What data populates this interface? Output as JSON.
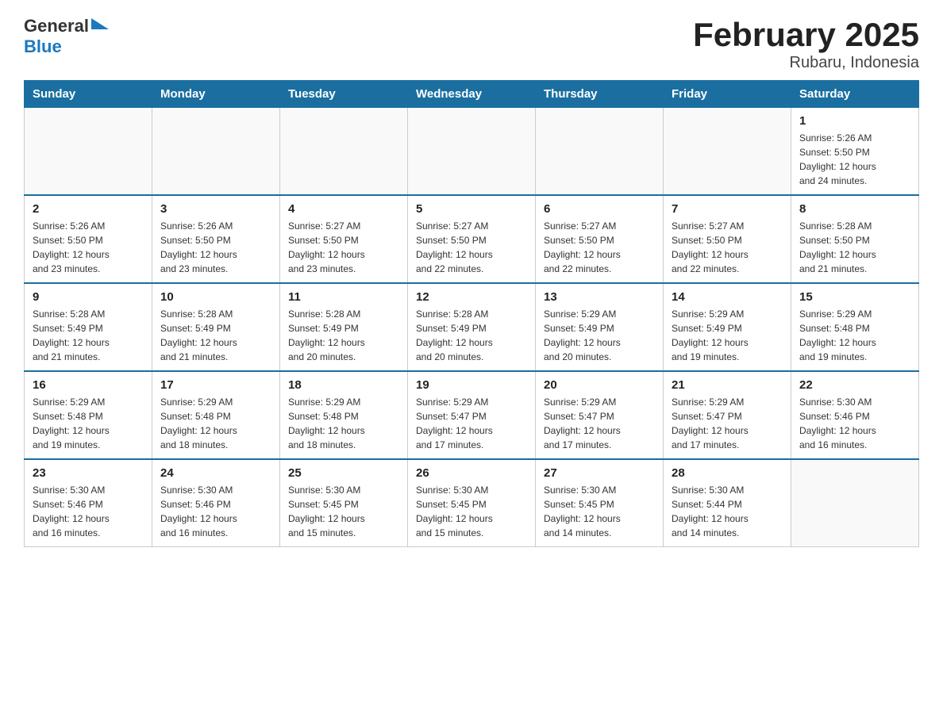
{
  "header": {
    "logo_general": "General",
    "logo_blue": "Blue",
    "title": "February 2025",
    "subtitle": "Rubaru, Indonesia"
  },
  "days_of_week": [
    "Sunday",
    "Monday",
    "Tuesday",
    "Wednesday",
    "Thursday",
    "Friday",
    "Saturday"
  ],
  "weeks": [
    [
      {
        "day": "",
        "info": ""
      },
      {
        "day": "",
        "info": ""
      },
      {
        "day": "",
        "info": ""
      },
      {
        "day": "",
        "info": ""
      },
      {
        "day": "",
        "info": ""
      },
      {
        "day": "",
        "info": ""
      },
      {
        "day": "1",
        "info": "Sunrise: 5:26 AM\nSunset: 5:50 PM\nDaylight: 12 hours\nand 24 minutes."
      }
    ],
    [
      {
        "day": "2",
        "info": "Sunrise: 5:26 AM\nSunset: 5:50 PM\nDaylight: 12 hours\nand 23 minutes."
      },
      {
        "day": "3",
        "info": "Sunrise: 5:26 AM\nSunset: 5:50 PM\nDaylight: 12 hours\nand 23 minutes."
      },
      {
        "day": "4",
        "info": "Sunrise: 5:27 AM\nSunset: 5:50 PM\nDaylight: 12 hours\nand 23 minutes."
      },
      {
        "day": "5",
        "info": "Sunrise: 5:27 AM\nSunset: 5:50 PM\nDaylight: 12 hours\nand 22 minutes."
      },
      {
        "day": "6",
        "info": "Sunrise: 5:27 AM\nSunset: 5:50 PM\nDaylight: 12 hours\nand 22 minutes."
      },
      {
        "day": "7",
        "info": "Sunrise: 5:27 AM\nSunset: 5:50 PM\nDaylight: 12 hours\nand 22 minutes."
      },
      {
        "day": "8",
        "info": "Sunrise: 5:28 AM\nSunset: 5:50 PM\nDaylight: 12 hours\nand 21 minutes."
      }
    ],
    [
      {
        "day": "9",
        "info": "Sunrise: 5:28 AM\nSunset: 5:49 PM\nDaylight: 12 hours\nand 21 minutes."
      },
      {
        "day": "10",
        "info": "Sunrise: 5:28 AM\nSunset: 5:49 PM\nDaylight: 12 hours\nand 21 minutes."
      },
      {
        "day": "11",
        "info": "Sunrise: 5:28 AM\nSunset: 5:49 PM\nDaylight: 12 hours\nand 20 minutes."
      },
      {
        "day": "12",
        "info": "Sunrise: 5:28 AM\nSunset: 5:49 PM\nDaylight: 12 hours\nand 20 minutes."
      },
      {
        "day": "13",
        "info": "Sunrise: 5:29 AM\nSunset: 5:49 PM\nDaylight: 12 hours\nand 20 minutes."
      },
      {
        "day": "14",
        "info": "Sunrise: 5:29 AM\nSunset: 5:49 PM\nDaylight: 12 hours\nand 19 minutes."
      },
      {
        "day": "15",
        "info": "Sunrise: 5:29 AM\nSunset: 5:48 PM\nDaylight: 12 hours\nand 19 minutes."
      }
    ],
    [
      {
        "day": "16",
        "info": "Sunrise: 5:29 AM\nSunset: 5:48 PM\nDaylight: 12 hours\nand 19 minutes."
      },
      {
        "day": "17",
        "info": "Sunrise: 5:29 AM\nSunset: 5:48 PM\nDaylight: 12 hours\nand 18 minutes."
      },
      {
        "day": "18",
        "info": "Sunrise: 5:29 AM\nSunset: 5:48 PM\nDaylight: 12 hours\nand 18 minutes."
      },
      {
        "day": "19",
        "info": "Sunrise: 5:29 AM\nSunset: 5:47 PM\nDaylight: 12 hours\nand 17 minutes."
      },
      {
        "day": "20",
        "info": "Sunrise: 5:29 AM\nSunset: 5:47 PM\nDaylight: 12 hours\nand 17 minutes."
      },
      {
        "day": "21",
        "info": "Sunrise: 5:29 AM\nSunset: 5:47 PM\nDaylight: 12 hours\nand 17 minutes."
      },
      {
        "day": "22",
        "info": "Sunrise: 5:30 AM\nSunset: 5:46 PM\nDaylight: 12 hours\nand 16 minutes."
      }
    ],
    [
      {
        "day": "23",
        "info": "Sunrise: 5:30 AM\nSunset: 5:46 PM\nDaylight: 12 hours\nand 16 minutes."
      },
      {
        "day": "24",
        "info": "Sunrise: 5:30 AM\nSunset: 5:46 PM\nDaylight: 12 hours\nand 16 minutes."
      },
      {
        "day": "25",
        "info": "Sunrise: 5:30 AM\nSunset: 5:45 PM\nDaylight: 12 hours\nand 15 minutes."
      },
      {
        "day": "26",
        "info": "Sunrise: 5:30 AM\nSunset: 5:45 PM\nDaylight: 12 hours\nand 15 minutes."
      },
      {
        "day": "27",
        "info": "Sunrise: 5:30 AM\nSunset: 5:45 PM\nDaylight: 12 hours\nand 14 minutes."
      },
      {
        "day": "28",
        "info": "Sunrise: 5:30 AM\nSunset: 5:44 PM\nDaylight: 12 hours\nand 14 minutes."
      },
      {
        "day": "",
        "info": ""
      }
    ]
  ]
}
